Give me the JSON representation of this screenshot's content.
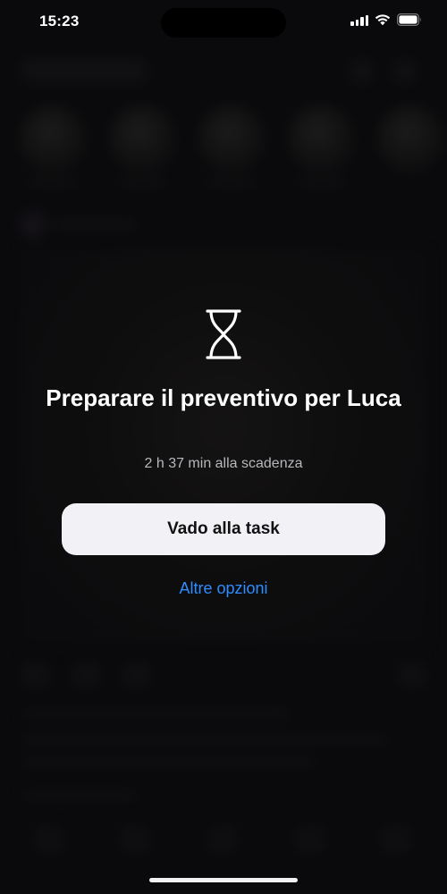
{
  "status_bar": {
    "time": "15:23"
  },
  "alert": {
    "icon": "hourglass-icon",
    "title": "Preparare il preventivo per Luca",
    "subtitle": "2 h 37 min alla scadenza",
    "primary_button_label": "Vado alla task",
    "secondary_link_label": "Altre opzioni"
  },
  "colors": {
    "background": "#0e0e10",
    "button_background": "#f1f1f6",
    "link": "#2f8cff",
    "subtitle": "#b7b7bc"
  }
}
